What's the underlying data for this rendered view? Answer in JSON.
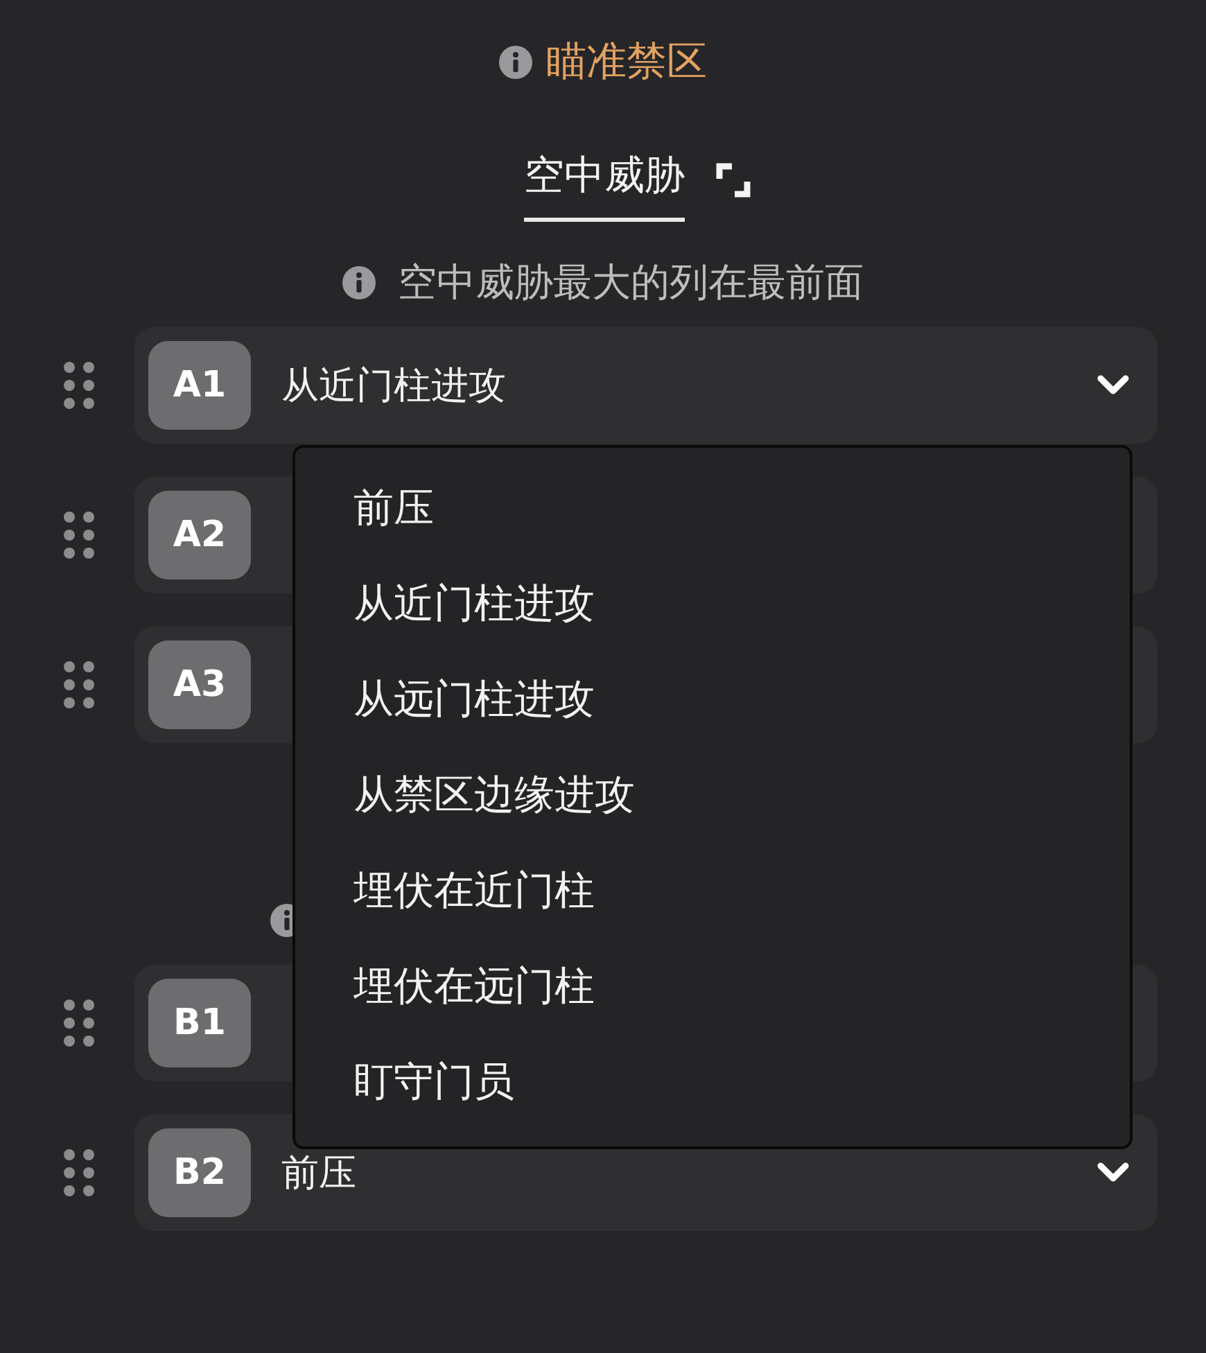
{
  "title": "瞄准禁区",
  "tab": {
    "label": "空中威胁",
    "selected": true
  },
  "sections": [
    {
      "hint": "空中威胁最大的列在最前面",
      "rows": [
        {
          "badge": "A1",
          "value": "从近门柱进攻"
        },
        {
          "badge": "A2"
        },
        {
          "badge": "A3"
        }
      ]
    },
    {
      "rows": [
        {
          "badge": "B1"
        },
        {
          "badge": "B2",
          "value": "前压"
        }
      ]
    }
  ],
  "dropdown": {
    "options": [
      "前压",
      "从近门柱进攻",
      "从远门柱进攻",
      "从禁区边缘进攻",
      "埋伏在近门柱",
      "埋伏在远门柱",
      "盯守门员"
    ]
  }
}
